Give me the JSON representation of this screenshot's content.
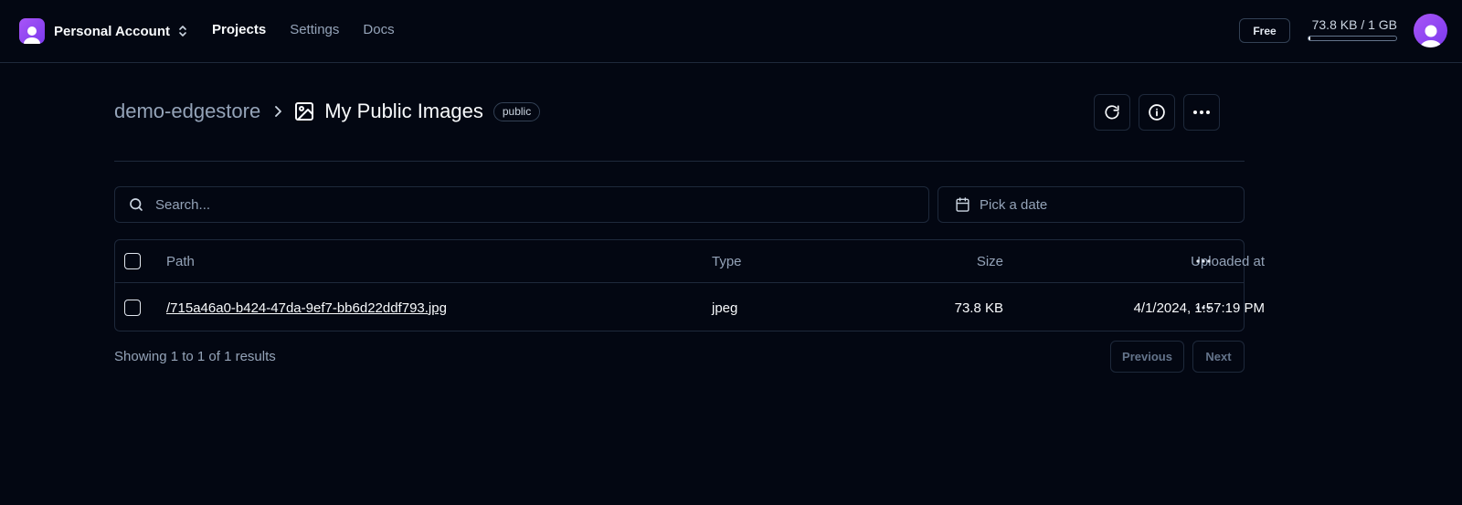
{
  "topbar": {
    "account_name": "Personal Account",
    "nav": [
      {
        "label": "Projects",
        "active": true
      },
      {
        "label": "Settings",
        "active": false
      },
      {
        "label": "Docs",
        "active": false
      }
    ],
    "plan": "Free",
    "usage_text": "73.8 KB / 1 GB",
    "usage_fraction": 0.0001
  },
  "header": {
    "project": "demo-edgestore",
    "bucket": "My Public Images",
    "visibility": "public"
  },
  "filters": {
    "search_placeholder": "Search...",
    "date_placeholder": "Pick a date"
  },
  "table": {
    "columns": {
      "path": "Path",
      "type": "Type",
      "size": "Size",
      "uploaded": "Uploaded at"
    },
    "rows": [
      {
        "path": "/715a46a0-b424-47da-9ef7-bb6d22ddf793.jpg",
        "type": "jpeg",
        "size": "73.8 KB",
        "uploaded": "4/1/2024, 1:57:19 PM"
      }
    ]
  },
  "pagination": {
    "summary": "Showing 1 to 1 of 1 results",
    "previous": "Previous",
    "next": "Next"
  },
  "colors": {
    "background": "#030712",
    "border": "#1e293b",
    "accent": "#a855f7",
    "text_muted": "#94a3b8"
  }
}
